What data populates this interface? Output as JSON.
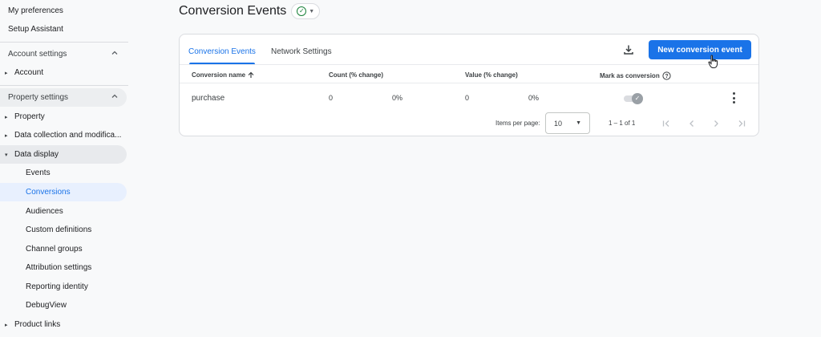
{
  "sidebar": {
    "top_items": [
      {
        "label": "My preferences"
      },
      {
        "label": "Setup Assistant"
      }
    ],
    "account_settings": {
      "label": "Account settings",
      "items": [
        {
          "label": "Account"
        }
      ]
    },
    "property_settings": {
      "label": "Property settings",
      "items": [
        {
          "label": "Property"
        },
        {
          "label": "Data collection and modifica..."
        },
        {
          "label": "Data display"
        }
      ],
      "data_display_children": [
        {
          "label": "Events"
        },
        {
          "label": "Conversions"
        },
        {
          "label": "Audiences"
        },
        {
          "label": "Custom definitions"
        },
        {
          "label": "Channel groups"
        },
        {
          "label": "Attribution settings"
        },
        {
          "label": "Reporting identity"
        },
        {
          "label": "DebugView"
        }
      ]
    },
    "product_links": {
      "label": "Product links"
    }
  },
  "header": {
    "title": "Conversion Events"
  },
  "tabs": [
    {
      "label": "Conversion Events",
      "active": true
    },
    {
      "label": "Network Settings",
      "active": false
    }
  ],
  "toolbar": {
    "new_button": "New conversion event"
  },
  "table": {
    "headers": {
      "name": "Conversion name",
      "count": "Count (% change)",
      "value": "Value (% change)",
      "mark": "Mark as conversion"
    },
    "rows": [
      {
        "name": "purchase",
        "count": "0",
        "count_change": "0%",
        "value": "0",
        "value_change": "0%",
        "mark_as_conversion": true
      }
    ]
  },
  "pagination": {
    "items_per_page_label": "Items per page:",
    "items_per_page_value": "10",
    "range": "1 – 1 of 1"
  },
  "colors": {
    "accent": "#1a73e8",
    "success": "#188038"
  }
}
